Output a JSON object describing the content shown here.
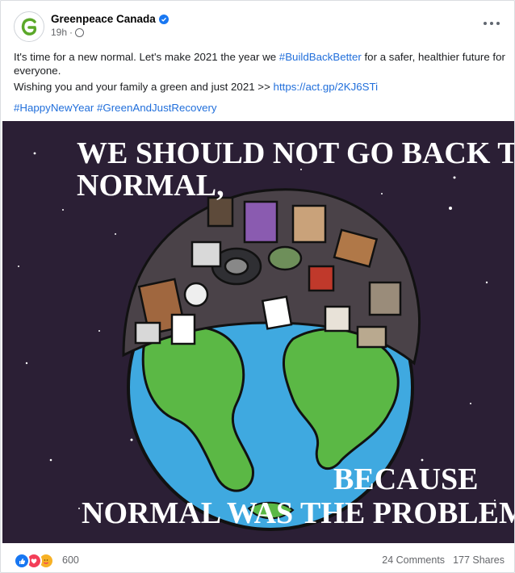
{
  "post": {
    "page_name": "Greenpeace Canada",
    "time": "19h",
    "message_line1_a": "It's time for a new normal. Let's make 2021 the year we ",
    "message_line1_hashtag": "#BuildBackBetter",
    "message_line1_b": " for a safer, healthier future for everyone.",
    "message_line2_a": "Wishing you and your family a green and just 2021 >> ",
    "message_line2_link": "https://act.gp/2KJ6STi",
    "hashtag_1": "#HappyNewYear",
    "hashtag_2": "#GreenAndJustRecovery"
  },
  "image": {
    "headline_top_line1": "WE SHOULD NOT GO BACK TO",
    "headline_top_line2": "NORMAL,",
    "headline_bottom_line1": "BECAUSE",
    "headline_bottom_line2": "NORMAL WAS THE PROBLEM."
  },
  "footer": {
    "reaction_count": "600",
    "comments": "24 Comments",
    "shares": "177 Shares"
  },
  "icons": {
    "avatar": "greenpeace-g-logo",
    "verified": "verified-badge-icon",
    "privacy": "globe-icon",
    "more": "more-options-icon"
  },
  "colors": {
    "link": "#216fdb",
    "image_background": "#2b1f35",
    "ocean": "#3fa9e0",
    "land": "#5bb845"
  }
}
